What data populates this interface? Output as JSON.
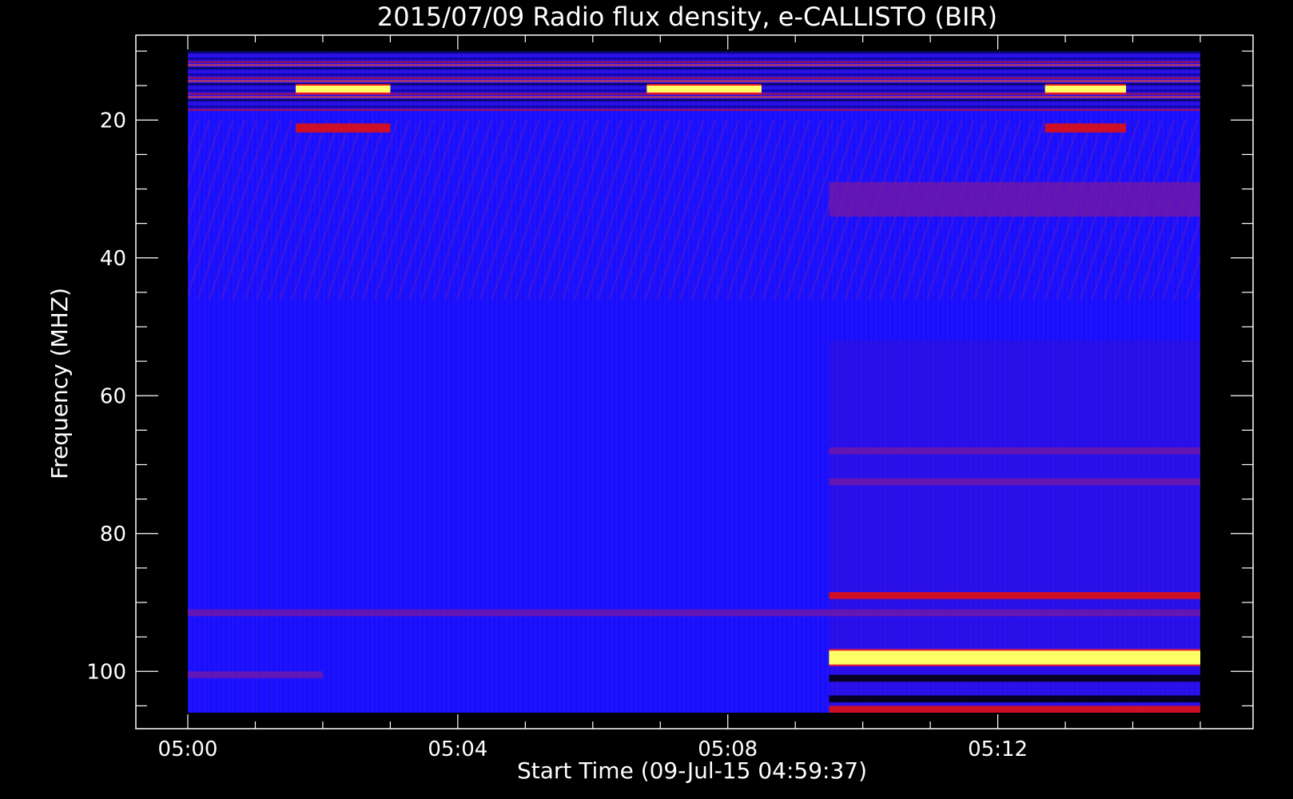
{
  "chart_data": {
    "type": "heatmap",
    "title": "2015/07/09  Radio flux density, e-CALLISTO (BIR)",
    "xlabel": "Start Time (09-Jul-15 04:59:37)",
    "ylabel": "Frequency (MHZ)",
    "x_range": [
      "05:00",
      "05:15"
    ],
    "y_range": [
      10,
      106
    ],
    "y_inverted": true,
    "x_ticks": [
      {
        "label": "05:00",
        "minute": 0
      },
      {
        "label": "05:04",
        "minute": 4
      },
      {
        "label": "05:08",
        "minute": 8
      },
      {
        "label": "05:12",
        "minute": 12
      }
    ],
    "y_ticks": [
      {
        "label": "20",
        "value": 20
      },
      {
        "label": "40",
        "value": 40
      },
      {
        "label": "60",
        "value": 60
      },
      {
        "label": "80",
        "value": 80
      },
      {
        "label": "100",
        "value": 100
      }
    ],
    "colormap": [
      "#000000",
      "#0000ff",
      "#ff0000",
      "#ffff66"
    ],
    "background_color": "#1414ff",
    "features": [
      {
        "t0": 0.0,
        "t1": 15.0,
        "f0": 10,
        "f1": 19,
        "intensity": "mixed"
      },
      {
        "t0": 1.6,
        "t1": 3.0,
        "f0": 15,
        "f1": 16,
        "intensity": "high"
      },
      {
        "t0": 1.6,
        "t1": 3.0,
        "f0": 20.5,
        "f1": 21.8,
        "intensity": "medium"
      },
      {
        "t0": 6.8,
        "t1": 8.5,
        "f0": 15,
        "f1": 16,
        "intensity": "high"
      },
      {
        "t0": 12.7,
        "t1": 13.9,
        "f0": 15,
        "f1": 16,
        "intensity": "high"
      },
      {
        "t0": 12.7,
        "t1": 13.9,
        "f0": 20.5,
        "f1": 21.8,
        "intensity": "medium"
      },
      {
        "t0": 9.5,
        "t1": 15.0,
        "f0": 29,
        "f1": 34,
        "intensity": "low"
      },
      {
        "t0": 9.5,
        "t1": 15.0,
        "f0": 67.5,
        "f1": 68.5,
        "intensity": "low"
      },
      {
        "t0": 9.5,
        "t1": 15.0,
        "f0": 72,
        "f1": 73,
        "intensity": "low"
      },
      {
        "t0": 9.5,
        "t1": 15.0,
        "f0": 88.5,
        "f1": 89.5,
        "intensity": "medium"
      },
      {
        "t0": 0.0,
        "t1": 15.0,
        "f0": 91,
        "f1": 92,
        "intensity": "low"
      },
      {
        "t0": 9.5,
        "t1": 15.0,
        "f0": 97,
        "f1": 99,
        "intensity": "high"
      },
      {
        "t0": 0.0,
        "t1": 2.0,
        "f0": 100,
        "f1": 101,
        "intensity": "low"
      },
      {
        "t0": 9.5,
        "t1": 15.0,
        "f0": 100.5,
        "f1": 101.5,
        "intensity": "dark"
      },
      {
        "t0": 9.5,
        "t1": 15.0,
        "f0": 103.5,
        "f1": 104.5,
        "intensity": "dark"
      },
      {
        "t0": 9.5,
        "t1": 15.0,
        "f0": 105,
        "f1": 106,
        "intensity": "medium"
      }
    ]
  }
}
